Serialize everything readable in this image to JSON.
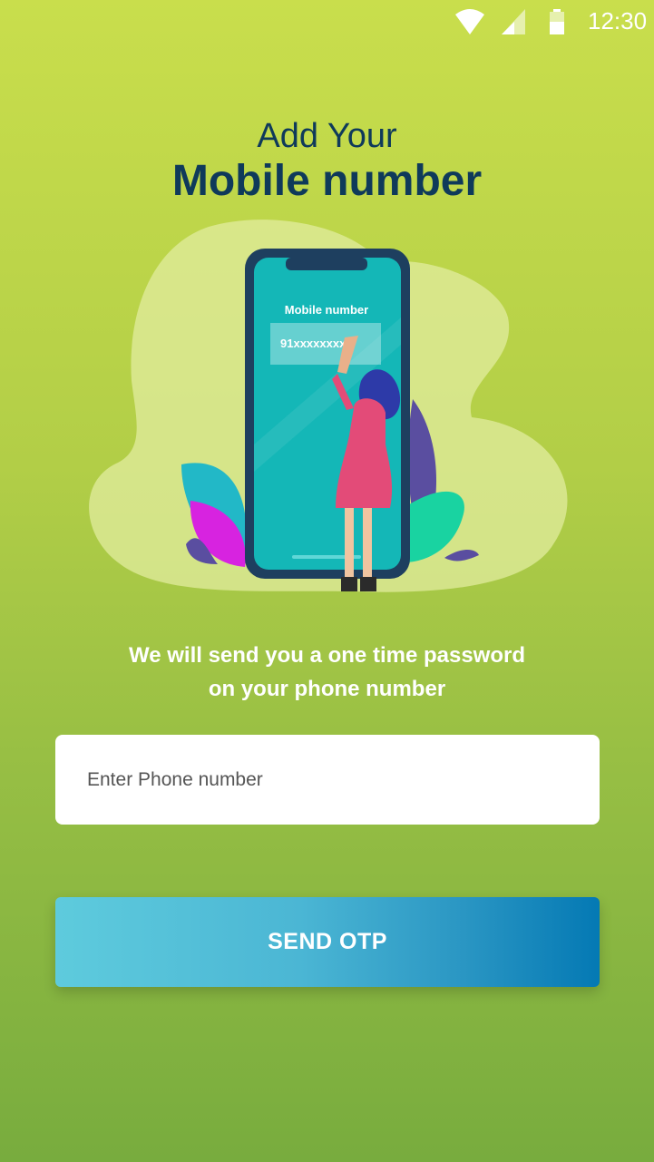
{
  "status_bar": {
    "time": "12:30",
    "icons": [
      "wifi-icon",
      "signal-icon",
      "battery-icon"
    ]
  },
  "header": {
    "line1": "Add Your",
    "line2": "Mobile number"
  },
  "illustration": {
    "screen_label": "Mobile number",
    "screen_value": "91xxxxxxxx"
  },
  "subtitle": {
    "line1": "We will send you a one time password",
    "line2": "on your phone number"
  },
  "phone_input": {
    "placeholder": "Enter Phone number",
    "value": ""
  },
  "send_button": {
    "label": "SEND OTP"
  },
  "colors": {
    "background_top": "#c9de4c",
    "background_bottom": "#78ac3e",
    "title": "#0f3a5a",
    "button_start": "#5ecbdd",
    "button_end": "#0479b4"
  }
}
